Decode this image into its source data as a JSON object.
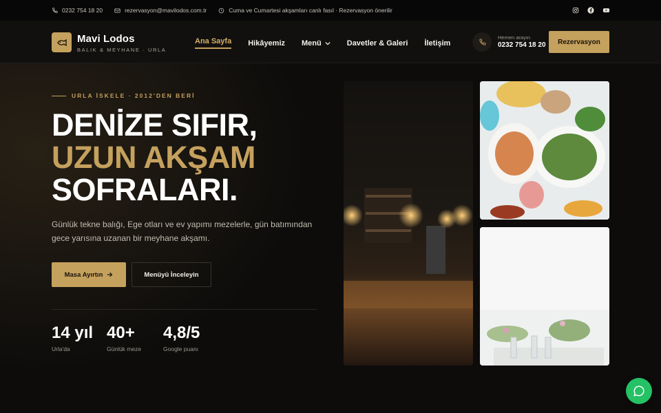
{
  "topbar": {
    "phone": "0232 754 18 20",
    "email": "rezervasyon@mavilodos.com.tr",
    "notice": "Cuma ve Cumartesi akşamları canlı fasıl · Rezervasyon önerilir",
    "social": [
      "instagram-icon",
      "facebook-icon",
      "youtube-icon"
    ]
  },
  "header": {
    "brand_name": "Mavi Lodos",
    "brand_sub": "BALIK & MEYHANE · URLA",
    "nav": [
      {
        "label": "Ana Sayfa",
        "active": true
      },
      {
        "label": "Hikâyemiz",
        "active": false
      },
      {
        "label": "Menü",
        "active": false,
        "dropdown": true
      },
      {
        "label": "Davetler & Galeri",
        "active": false
      },
      {
        "label": "İletişim",
        "active": false
      }
    ],
    "phone_label": "Hemen arayın",
    "phone_number": "0232 754 18 20",
    "reserve_label": "Rezervasyon"
  },
  "hero": {
    "eyebrow": "URLA İSKELE · 2012'DEN BERİ",
    "headline_1": "DENİZE SIFIR,",
    "headline_2": "UZUN AKŞAM",
    "headline_3": "SOFRALARI.",
    "lead": "Günlük tekne balığı, Ege otları ve ev yapımı mezelerle, gün batımından gece yarısına uzanan bir meyhane akşamı.",
    "primary_cta": "Masa Ayırtın",
    "secondary_cta": "Menüyü İnceleyin"
  },
  "stats": [
    {
      "value": "14 yıl",
      "label": "Urla'da"
    },
    {
      "value": "40+",
      "label": "Günlük meze"
    },
    {
      "value": "4,8/5",
      "label": "Google puanı"
    }
  ],
  "colors": {
    "accent": "#c5a15e",
    "background": "#0d0c0b",
    "chat": "#25c165"
  }
}
